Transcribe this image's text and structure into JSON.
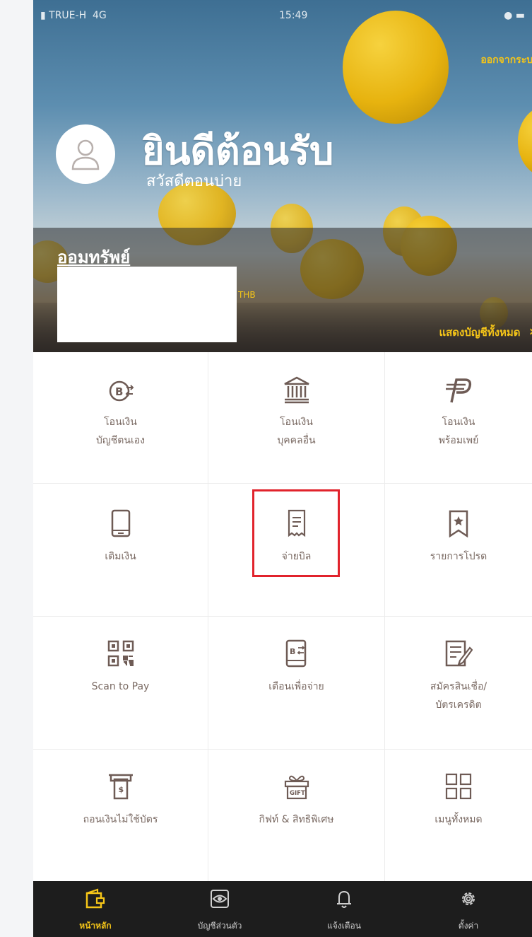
{
  "status_bar": {
    "carrier": "TRUE-H",
    "network": "4G",
    "time": "15:49"
  },
  "header": {
    "logout": "ออกจากระบบ",
    "welcome": "ยินดีต้อนรับ",
    "greeting": "สวัสดีตอนบ่าย"
  },
  "account": {
    "name": "ออมทรัพย์",
    "currency": "THB",
    "show_all": "แสดงบัญชีทั้งหมด"
  },
  "menu": [
    {
      "line1": "โอนเงิน",
      "line2": "บัญชีตนเอง",
      "icon": "own-transfer-icon"
    },
    {
      "line1": "โอนเงิน",
      "line2": "บุคคลอื่น",
      "icon": "bank-icon"
    },
    {
      "line1": "โอนเงิน",
      "line2": "พร้อมเพย์",
      "icon": "promptpay-icon"
    },
    {
      "line1": "เติมเงิน",
      "line2": "",
      "icon": "phone-icon"
    },
    {
      "line1": "จ่ายบิล",
      "line2": "",
      "icon": "bill-icon"
    },
    {
      "line1": "รายการโปรด",
      "line2": "",
      "icon": "favorite-icon"
    },
    {
      "line1": "Scan to Pay",
      "line2": "",
      "icon": "qr-code-icon"
    },
    {
      "line1": "เตือนเพื่อจ่าย",
      "line2": "",
      "icon": "reminder-icon"
    },
    {
      "line1": "สมัครสินเชื่อ/",
      "line2": "บัตรเครดิต",
      "icon": "loan-form-icon"
    },
    {
      "line1": "ถอนเงินไม่ใช้บัตร",
      "line2": "",
      "icon": "atm-icon"
    },
    {
      "line1": "กิฟท์ & สิทธิพิเศษ",
      "line2": "",
      "icon": "gift-icon"
    },
    {
      "line1": "เมนูทั้งหมด",
      "line2": "",
      "icon": "all-menu-icon"
    }
  ],
  "tabs": [
    {
      "label": "หน้าหลัก",
      "icon": "wallet-icon",
      "active": true
    },
    {
      "label": "บัญชีส่วนตัว",
      "icon": "eye-icon",
      "active": false
    },
    {
      "label": "แจ้งเตือน",
      "icon": "bell-icon",
      "active": false
    },
    {
      "label": "ตั้งค่า",
      "icon": "gear-icon",
      "active": false
    }
  ],
  "colors": {
    "accent": "#f5c518",
    "highlight": "#e1232c",
    "icon": "#6e5b55",
    "tabbar": "#1d1d1d"
  }
}
